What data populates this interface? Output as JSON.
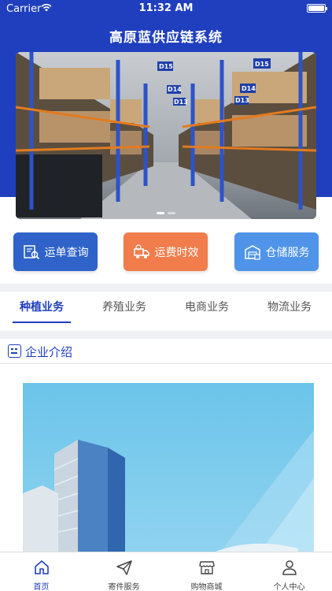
{
  "status_bar": {
    "carrier": "Carrier",
    "time": "11:32 AM"
  },
  "app": {
    "title": "高原蓝供应链系统"
  },
  "banner": {
    "rack_labels": [
      "D15",
      "D14",
      "D13",
      "D15",
      "D14",
      "D13"
    ],
    "page_count": 2,
    "active_index": 0
  },
  "quick_actions": [
    {
      "label": "运单查询",
      "icon": "waybill-search-icon",
      "color": "#2f63c9"
    },
    {
      "label": "运费时效",
      "icon": "truck-clock-icon",
      "color": "#f07d4b"
    },
    {
      "label": "仓储服务",
      "icon": "warehouse-icon",
      "color": "#4f94e8"
    }
  ],
  "business_tabs": [
    {
      "label": "种植业务",
      "active": true
    },
    {
      "label": "养殖业务",
      "active": false
    },
    {
      "label": "电商业务",
      "active": false
    },
    {
      "label": "物流业务",
      "active": false
    }
  ],
  "company_section": {
    "title": "企业介绍",
    "icon": "company-intro-icon"
  },
  "tab_bar": [
    {
      "label": "首页",
      "icon": "home-icon",
      "active": true
    },
    {
      "label": "寄件服务",
      "icon": "send-icon",
      "active": false
    },
    {
      "label": "购物商城",
      "icon": "store-icon",
      "active": false
    },
    {
      "label": "个人中心",
      "icon": "user-icon",
      "active": false
    }
  ],
  "colors": {
    "brand": "#1f3fbf",
    "background": "#ffffff",
    "separator": "#eef0f4"
  }
}
